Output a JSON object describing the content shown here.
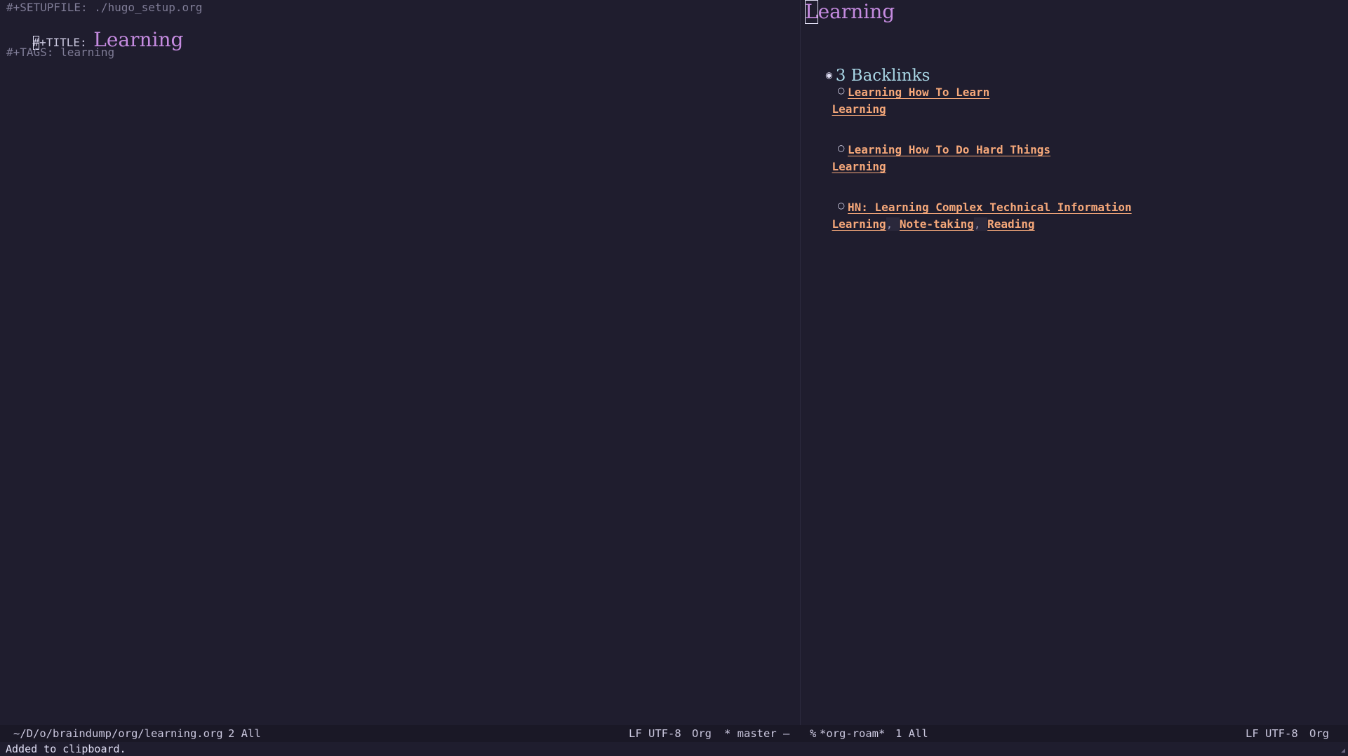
{
  "left_buffer": {
    "setupfile_line": "#+SETUPFILE: ./hugo_setup.org",
    "title_cursor_char": "#",
    "title_keyword": "+TITLE:",
    "title_value": "Learning",
    "tags_line": "#+TAGS: learning"
  },
  "right_buffer": {
    "title_cursor_char": "L",
    "title_rest": "earning",
    "backlinks_bullet": "◉",
    "backlinks_heading": "3 Backlinks",
    "entry_bullet": "○",
    "entries": [
      {
        "title": "Learning How To Learn",
        "tags": [
          "Learning"
        ]
      },
      {
        "title": "Learning How To Do Hard Things",
        "tags": [
          "Learning"
        ]
      },
      {
        "title": "HN: Learning Complex Technical Information",
        "tags": [
          "Learning",
          "Note-taking",
          "Reading"
        ]
      }
    ],
    "tag_separator": ","
  },
  "modeline_left": {
    "path": "~/D/o/braindump/org/learning.org",
    "position": "2 All",
    "encoding": "LF UTF-8",
    "mode": "Org",
    "vc": "* master",
    "dash": "–"
  },
  "modeline_right": {
    "state": "%",
    "buffer": "*org-roam*",
    "position": "1 All",
    "encoding": "LF UTF-8",
    "mode": "Org"
  },
  "echo_area": "Added to clipboard.",
  "colors": {
    "background": "#1f1d2e",
    "link": "#f6a87a",
    "title": "#c58be0",
    "heading": "#a9d6e5",
    "keyword": "#7f7c96"
  }
}
